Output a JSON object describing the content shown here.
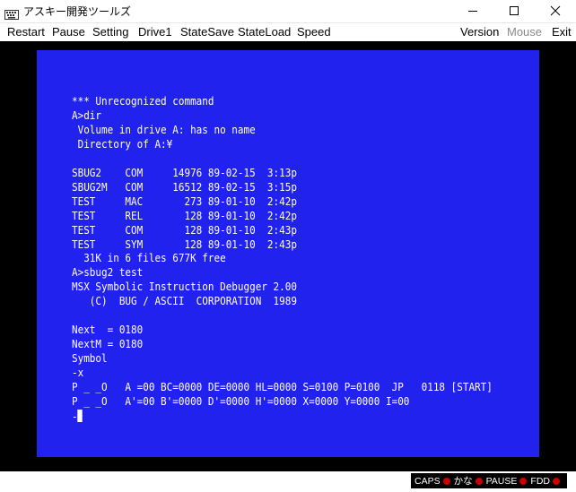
{
  "window": {
    "title": "アスキー開発ツールズ"
  },
  "menu": {
    "items": [
      {
        "label": "Restart",
        "enabled": true
      },
      {
        "label": "Pause",
        "enabled": true
      },
      {
        "label": "Setting",
        "enabled": true
      },
      {
        "label": "Drive1",
        "enabled": true
      },
      {
        "label": "StateSave",
        "enabled": true
      },
      {
        "label": "StateLoad",
        "enabled": true
      },
      {
        "label": "Speed",
        "enabled": true
      },
      {
        "label": "Version",
        "enabled": true
      },
      {
        "label": "Mouse",
        "enabled": false
      },
      {
        "label": "Exit",
        "enabled": true
      }
    ]
  },
  "screen": {
    "background_color": "#2222ee",
    "text_color": "#ffffff",
    "lines": [
      "*** Unrecognized command",
      "A>dir",
      " Volume in drive A: has no name",
      " Directory of A:¥",
      "",
      "SBUG2    COM     14976 89-02-15  3:13p",
      "SBUG2M   COM     16512 89-02-15  3:15p",
      "TEST     MAC       273 89-01-10  2:42p",
      "TEST     REL       128 89-01-10  2:42p",
      "TEST     COM       128 89-01-10  2:43p",
      "TEST     SYM       128 89-01-10  2:43p",
      "  31K in 6 files 677K free",
      "A>sbug2 test",
      "MSX Symbolic Instruction Debugger 2.00",
      "   (C)  BUG / ASCII  CORPORATION  1989",
      "",
      "Next  = 0180",
      "NextM = 0180",
      "Symbol",
      "-x",
      "P _ _O   A =00 BC=0000 DE=0000 HL=0000 S=0100 P=0100  JP   0118 [START]",
      "P _ _O   A'=00 B'=0000 D'=0000 H'=0000 X=0000 Y=0000 I=00",
      "-"
    ]
  },
  "status": {
    "indicators": [
      {
        "label": "CAPS",
        "led_color": "#cc0000"
      },
      {
        "label": "かな",
        "led_color": "#cc0000"
      },
      {
        "label": "PAUSE",
        "led_color": "#cc0000"
      },
      {
        "label": "FDD",
        "led_color": "#cc0000"
      }
    ]
  },
  "icons": {
    "app": "keyboard-icon",
    "minimize": "minimize-icon",
    "maximize": "maximize-icon",
    "close": "close-icon"
  }
}
